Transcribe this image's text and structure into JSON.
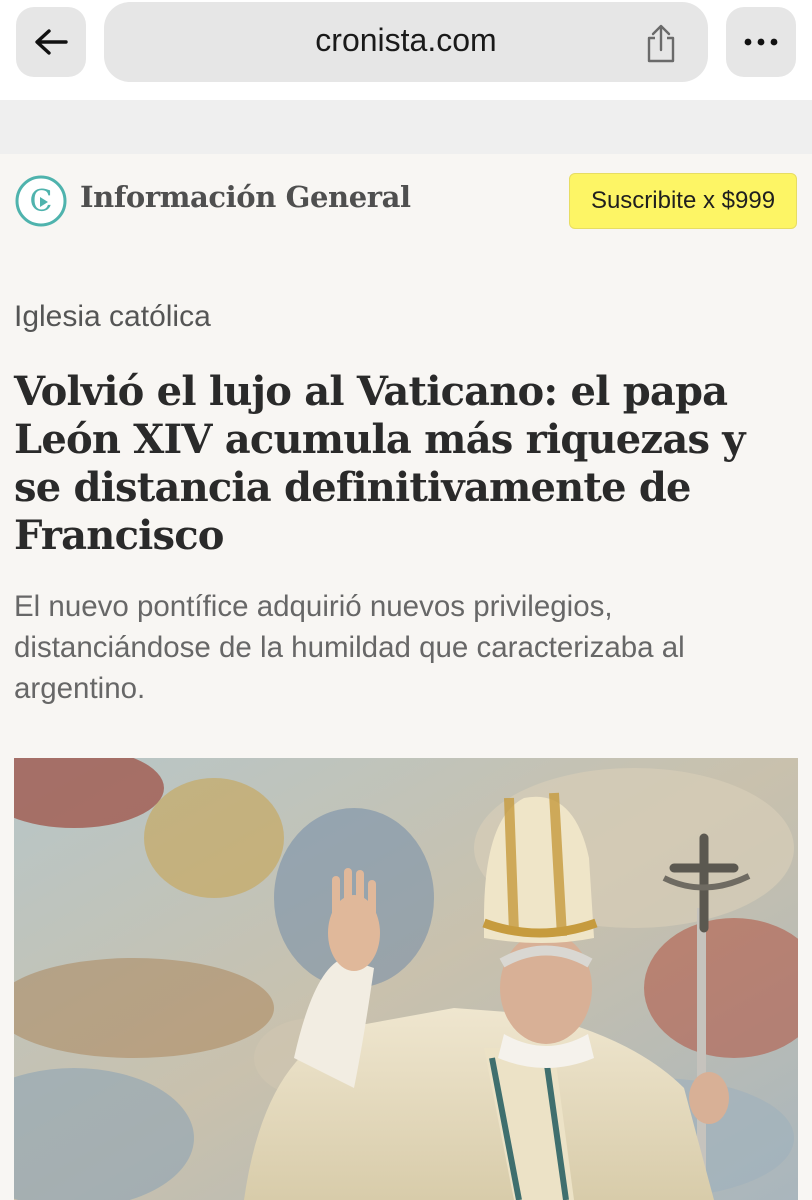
{
  "browser": {
    "url": "cronista.com",
    "back_icon": "arrow-left-icon",
    "share_icon": "share-icon",
    "more_icon": "ellipsis-icon"
  },
  "header": {
    "logo_icon": "cronista-logo-icon",
    "section": "Información General",
    "subscribe_label": "Suscribite x $999"
  },
  "article": {
    "category": "Iglesia católica",
    "headline": "Volvió el lujo al Vaticano: el papa León XIV acumula más riquezas y se distancia definitivamente de Francisco",
    "summary": "El nuevo pontífice adquirió nuevos privilegios, distanciándose de la humildad que caracterizaba al argentino."
  },
  "colors": {
    "accent_teal": "#4fb3ad",
    "subscribe_bg": "#fdf565",
    "page_bg": "#f8f6f3"
  }
}
